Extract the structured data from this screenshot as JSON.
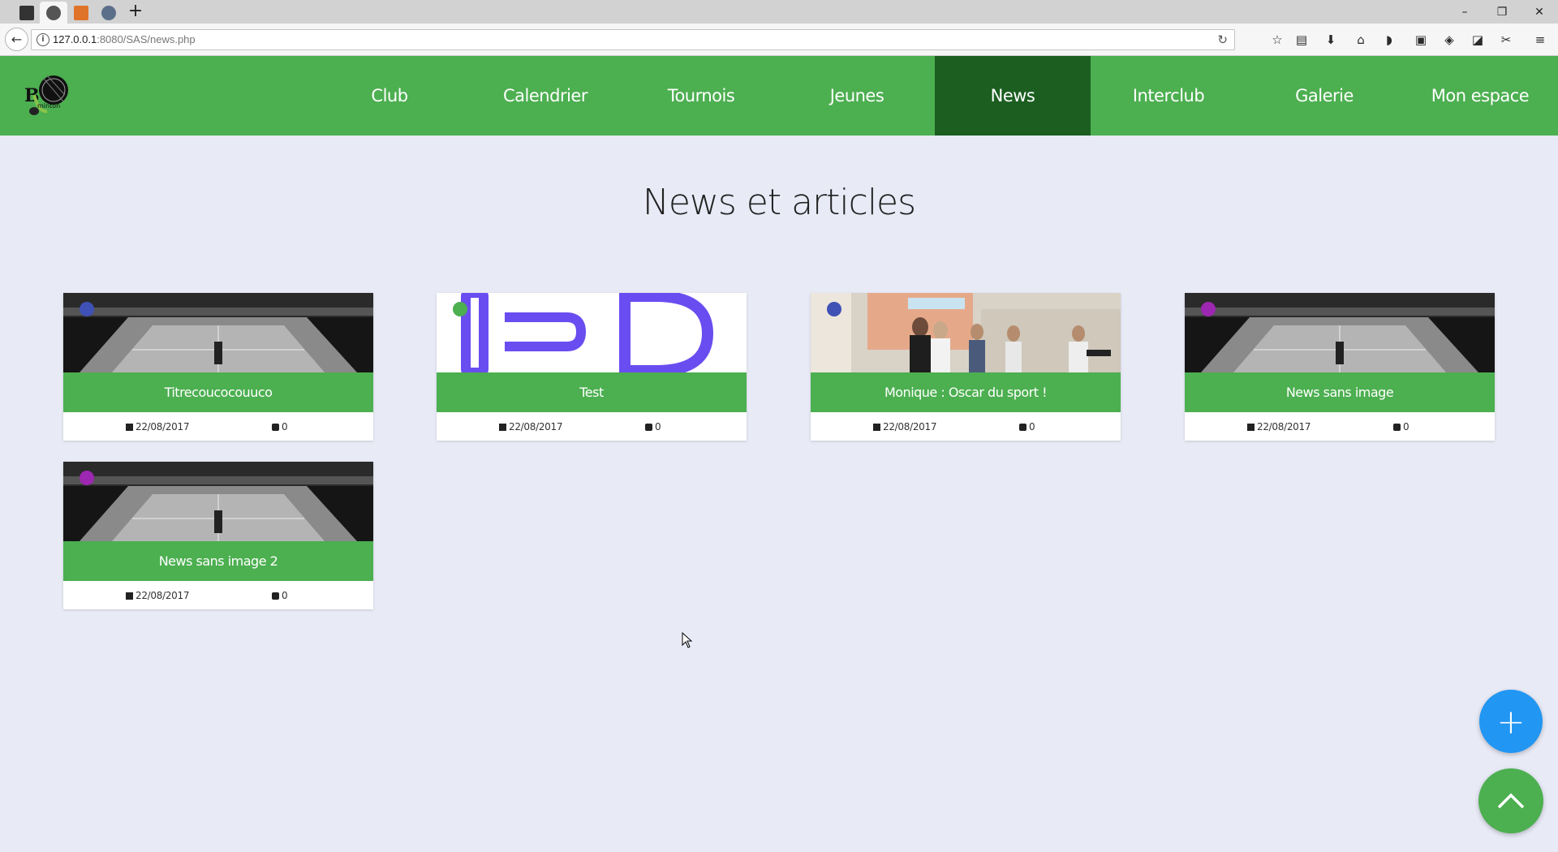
{
  "browser": {
    "tabs": [
      {
        "icon": "media-tab-icon",
        "color": "#333333"
      },
      {
        "icon": "globe-tab-icon",
        "color": "#555555",
        "active": true
      },
      {
        "icon": "pma-tab-icon",
        "color": "#e0732a"
      },
      {
        "icon": "gear-tab-icon",
        "color": "#5c6f8a"
      }
    ],
    "new_tab_label": "+",
    "window_controls": {
      "minimize": "–",
      "restore": "❐",
      "close": "✕"
    },
    "back_icon": "←",
    "url_info_icon": "i",
    "url_host": "127.0.0.1",
    "url_rest": ":8080/SAS/news.php",
    "reload_icon": "↻",
    "toolbar_icons": [
      "☆",
      "▤",
      "⬇",
      "⌂",
      "◗",
      "▣",
      "◈",
      "◪",
      "✂",
      "≡"
    ]
  },
  "site": {
    "logo_alt": "Badminton",
    "menu": [
      {
        "label": "Club",
        "active": false
      },
      {
        "label": "Calendrier",
        "active": false
      },
      {
        "label": "Tournois",
        "active": false
      },
      {
        "label": "Jeunes",
        "active": false
      },
      {
        "label": "News",
        "active": true
      },
      {
        "label": "Interclub",
        "active": false
      },
      {
        "label": "Galerie",
        "active": false
      },
      {
        "label": "Mon espace",
        "active": false
      }
    ]
  },
  "main": {
    "title": "News et articles",
    "articles": [
      {
        "title": "Titrecoucocouuco",
        "date": "22/08/2017",
        "comments": "0",
        "dot_color": "#3f51b5",
        "image": "arena"
      },
      {
        "title": "Test",
        "date": "22/08/2017",
        "comments": "0",
        "dot_color": "#4caf50",
        "image": "logo"
      },
      {
        "title": "Monique : Oscar du sport !",
        "date": "22/08/2017",
        "comments": "0",
        "dot_color": "#3f51b5",
        "image": "photo"
      },
      {
        "title": "News sans image",
        "date": "22/08/2017",
        "comments": "0",
        "dot_color": "#9c27b0",
        "image": "arena"
      },
      {
        "title": "News sans image 2",
        "date": "22/08/2017",
        "comments": "0",
        "dot_color": "#9c27b0",
        "image": "arena"
      }
    ]
  },
  "fab": {
    "add_label": "+",
    "top_icon": "chevron-up-icon"
  },
  "colors": {
    "primary": "#4caf50",
    "primary_dark": "#1b5e20",
    "accent": "#2196f3",
    "background": "#e8eaf6"
  }
}
